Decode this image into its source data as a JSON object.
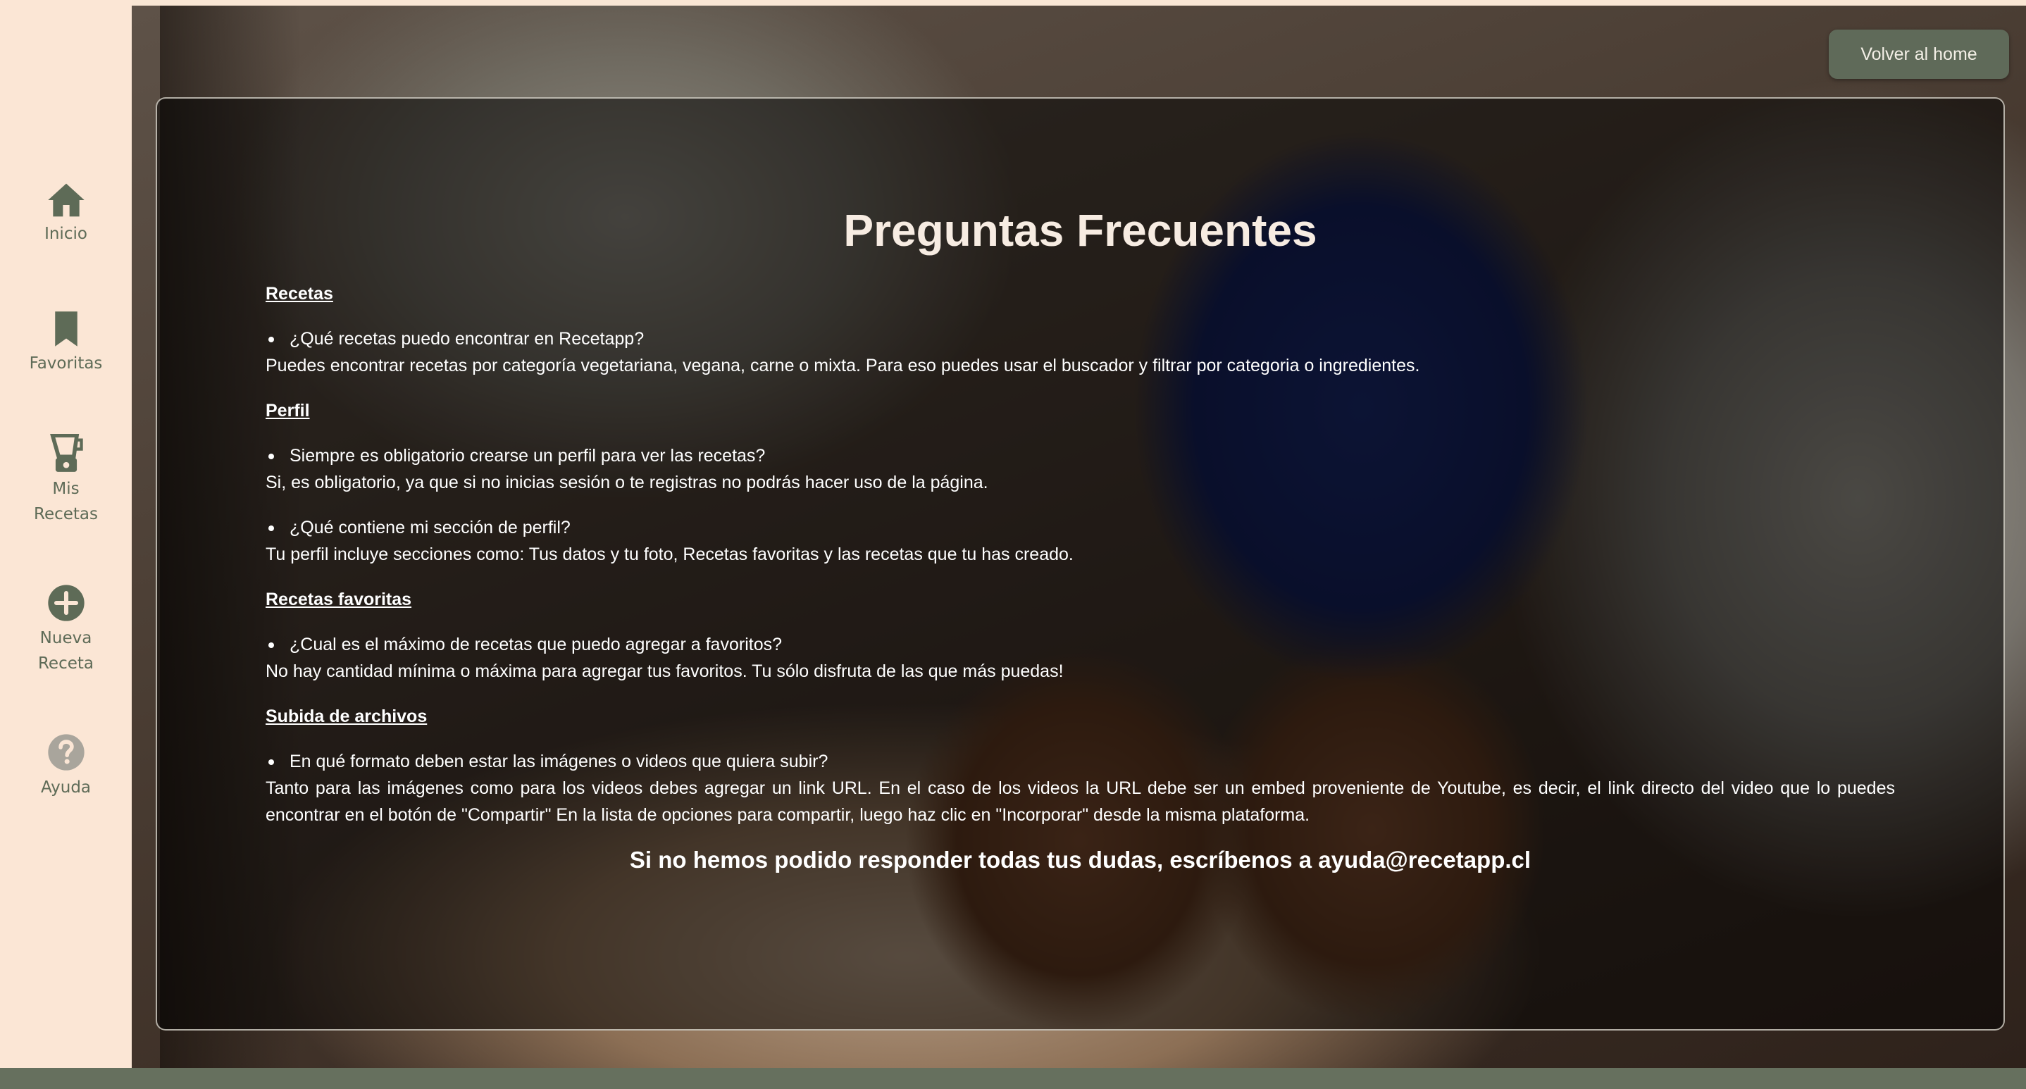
{
  "sidebar": {
    "items": [
      {
        "label": "Inicio",
        "icon": "home-icon"
      },
      {
        "label": "Favoritas",
        "icon": "bookmark-icon"
      },
      {
        "label_line1": "Mis",
        "label_line2": "Recetas",
        "icon": "blender-icon"
      },
      {
        "label_line1": "Nueva",
        "label_line2": "Receta",
        "icon": "add-circle-icon"
      },
      {
        "label": "Ayuda",
        "icon": "help-circle-icon"
      }
    ]
  },
  "header": {
    "home_button_label": "Volver al home"
  },
  "faq": {
    "title": "Preguntas Frecuentes",
    "sections": [
      {
        "heading": "Recetas",
        "items": [
          {
            "question": "¿Qué recetas puedo encontrar en Recetapp?",
            "answer": "Puedes encontrar recetas por categoría vegetariana, vegana, carne o mixta. Para eso puedes usar el buscador y filtrar por categoria o ingredientes."
          }
        ]
      },
      {
        "heading": "Perfil",
        "items": [
          {
            "question": "Siempre es obligatorio crearse un perfil para ver las recetas?",
            "answer": "Si, es obligatorio, ya que si no inicias sesión o te registras no podrás hacer uso de la página."
          },
          {
            "question": "¿Qué contiene mi sección de perfil?",
            "answer": "Tu perfil incluye secciones como: Tus datos y tu foto, Recetas favoritas y las recetas que tu has creado."
          }
        ]
      },
      {
        "heading": "Recetas favoritas",
        "items": [
          {
            "question": "¿Cual es el máximo de recetas que puedo agregar a favoritos?",
            "answer": "No hay cantidad mínima o máxima para agregar tus favoritos. Tu sólo disfruta de las que más puedas!"
          }
        ]
      },
      {
        "heading": "Subida de archivos",
        "items": [
          {
            "question": "En qué formato deben estar las imágenes o videos que quiera subir?",
            "answer": "Tanto para las imágenes como para los videos debes agregar un link URL. En el caso de los videos la URL debe ser un embed proveniente de Youtube, es decir, el link directo del video que lo puedes encontrar en el botón de \"Compartir\" En la lista de opciones para compartir, luego haz clic en \"Incorporar\" desde la misma plataforma."
          }
        ]
      }
    ],
    "contact": "Si no hemos podido responder todas tus dudas, escríbenos a ayuda@recetapp.cl"
  },
  "colors": {
    "sidebar_bg": "#fbe6d5",
    "accent": "#5f6a59",
    "icon_color": "#5e6b57"
  }
}
